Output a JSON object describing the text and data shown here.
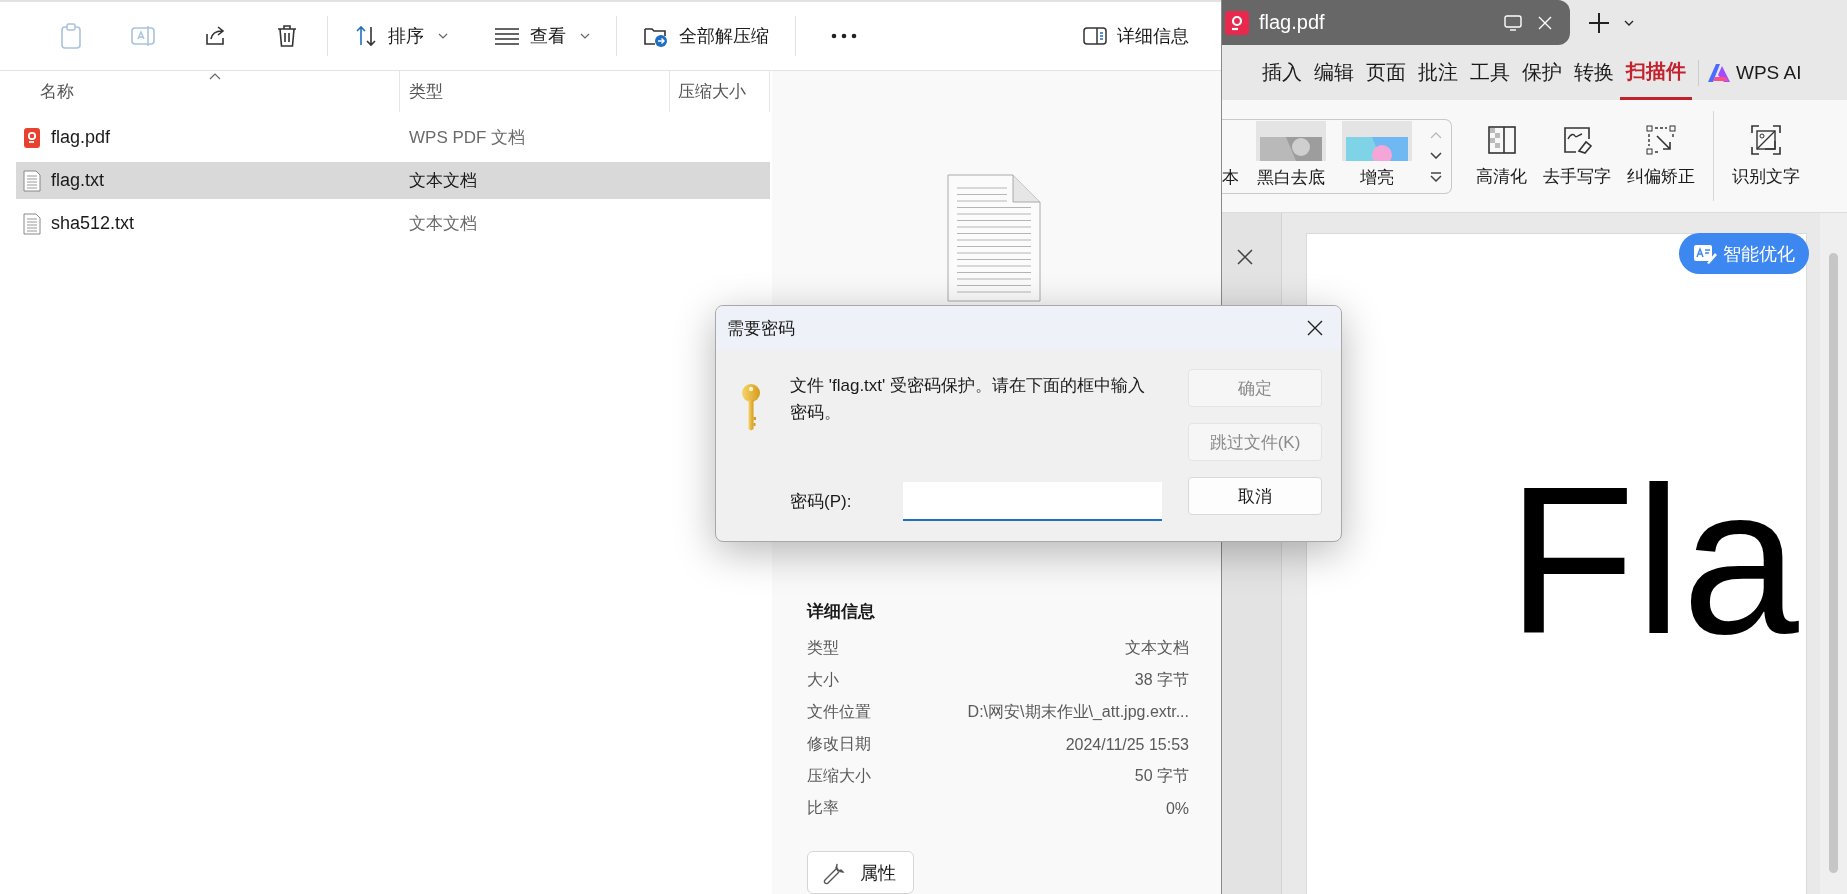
{
  "explorer": {
    "toolbar": [
      {
        "kind": "paste",
        "disabled": true
      },
      {
        "kind": "rename",
        "disabled": true
      },
      {
        "kind": "share",
        "disabled": false
      },
      {
        "kind": "delete",
        "disabled": false
      },
      {
        "kind": "divider"
      },
      {
        "kind": "sort",
        "label": "排序"
      },
      {
        "kind": "view",
        "label": "查看"
      },
      {
        "kind": "divider"
      },
      {
        "kind": "extract",
        "label": "全部解压缩"
      },
      {
        "kind": "divider"
      },
      {
        "kind": "more"
      },
      {
        "kind": "details",
        "label": "详细信息"
      }
    ],
    "columns": [
      {
        "label": "名称",
        "sorted": true
      },
      {
        "label": "类型",
        "sorted": false
      },
      {
        "label": "压缩大小",
        "sorted": false
      }
    ],
    "files": [
      {
        "kind": "pdf",
        "name": "flag.pdf",
        "type": "WPS PDF 文档",
        "selected": false
      },
      {
        "kind": "txt",
        "name": "flag.txt",
        "type": "文本文档",
        "selected": true
      },
      {
        "kind": "txt",
        "name": "sha512.txt",
        "type": "文本文档",
        "selected": false
      }
    ],
    "details": {
      "heading": "详细信息",
      "rows": [
        {
          "label": "类型",
          "value": "文本文档"
        },
        {
          "label": "大小",
          "value": "38 字节"
        },
        {
          "label": "文件位置",
          "value": "D:\\网安\\期末作业\\_att.jpg.extr..."
        },
        {
          "label": "修改日期",
          "value": "2024/11/25 15:53"
        },
        {
          "label": "压缩大小",
          "value": "50 字节"
        },
        {
          "label": "比率",
          "value": "0%"
        }
      ],
      "button": "属性"
    }
  },
  "wps": {
    "tab": {
      "title": "flag.pdf"
    },
    "menu": [
      {
        "label": "插入",
        "selected": false
      },
      {
        "label": "编辑",
        "selected": false
      },
      {
        "label": "页面",
        "selected": false
      },
      {
        "label": "批注",
        "selected": false
      },
      {
        "label": "工具",
        "selected": false
      },
      {
        "label": "保护",
        "selected": false
      },
      {
        "label": "转换",
        "selected": false
      },
      {
        "label": "扫描件",
        "selected": true
      }
    ],
    "ai_label": "WPS AI",
    "gallery": [
      {
        "label": "本"
      },
      {
        "label": "黑白去底",
        "kind": "mono"
      },
      {
        "label": "增亮",
        "kind": "bright"
      }
    ],
    "tools": [
      {
        "kind": "hd",
        "label": "高清化"
      },
      {
        "kind": "erase",
        "label": "去手写字"
      },
      {
        "kind": "deskew",
        "label": "纠偏矫正"
      },
      {
        "kind": "divider"
      },
      {
        "kind": "ocr",
        "label": "识别文字"
      }
    ],
    "optimize_button": "智能优化",
    "page_text": "Fla"
  },
  "dialog": {
    "title": "需要密码",
    "message": "文件 'flag.txt' 受密码保护。请在下面的框中输入密码。",
    "password_label": "密码(P):",
    "buttons": [
      {
        "label": "确定",
        "disabled": true
      },
      {
        "label": "跳过文件(K)",
        "disabled": true
      },
      {
        "label": "取消",
        "disabled": false
      }
    ]
  }
}
